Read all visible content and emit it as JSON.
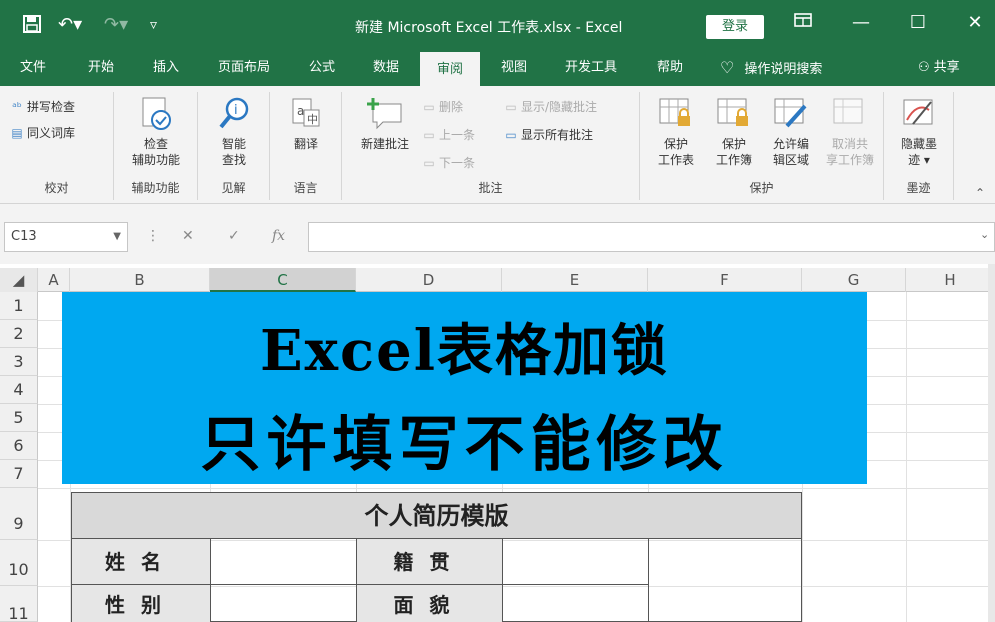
{
  "titlebar": {
    "title": "新建 Microsoft Excel 工作表.xlsx  -  Excel",
    "login": "登录",
    "icons": [
      "save-icon",
      "undo-icon",
      "redo-icon",
      "customize-icon"
    ],
    "controls": [
      "ribbon-display-icon",
      "minimize-icon",
      "maximize-icon",
      "close-icon"
    ]
  },
  "tabs": {
    "items": [
      "文件",
      "开始",
      "插入",
      "页面布局",
      "公式",
      "数据",
      "审阅",
      "视图",
      "开发工具",
      "帮助"
    ],
    "active": "审阅",
    "tell_me": "操作说明搜索",
    "share": "共享"
  },
  "ribbon": {
    "proofing": {
      "label": "校对",
      "spell": "拼写检查",
      "thesaurus": "同义词库"
    },
    "accessibility": {
      "label": "辅助功能",
      "check": "检查\n辅助功能"
    },
    "insights": {
      "label": "见解",
      "smart": "智能\n查找"
    },
    "language": {
      "label": "语言",
      "translate": "翻译"
    },
    "comments": {
      "label": "批注",
      "new": "新建批注",
      "delete": "删除",
      "prev": "上一条",
      "next": "下一条",
      "show_hide": "显示/隐藏批注",
      "show_all": "显示所有批注"
    },
    "protect": {
      "label": "保护",
      "sheet": "保护\n工作表",
      "workbook": "保护\n工作簿",
      "allow_edit": "允许编\n辑区域",
      "unshare": "取消共\n享工作簿"
    },
    "ink": {
      "label": "墨迹",
      "hide": "隐藏墨\n迹 ▾"
    }
  },
  "formula_bar": {
    "name_box": "C13",
    "value": ""
  },
  "sheet": {
    "columns": [
      "A",
      "B",
      "C",
      "D",
      "E",
      "F",
      "G",
      "H"
    ],
    "selected_column": "C",
    "rows": [
      "1",
      "2",
      "3",
      "4",
      "5",
      "6",
      "7",
      "9",
      "10",
      "11"
    ]
  },
  "banner": {
    "line1": "Excel表格加锁",
    "line2": "只许填写不能修改"
  },
  "resume": {
    "title": "个人简历模版",
    "name_label": "姓名",
    "gender_label": "性别",
    "origin_label": "籍贯",
    "appearance_label": "面貌"
  },
  "colors": {
    "excel_green": "#217346",
    "banner_blue": "#00a8f0"
  }
}
